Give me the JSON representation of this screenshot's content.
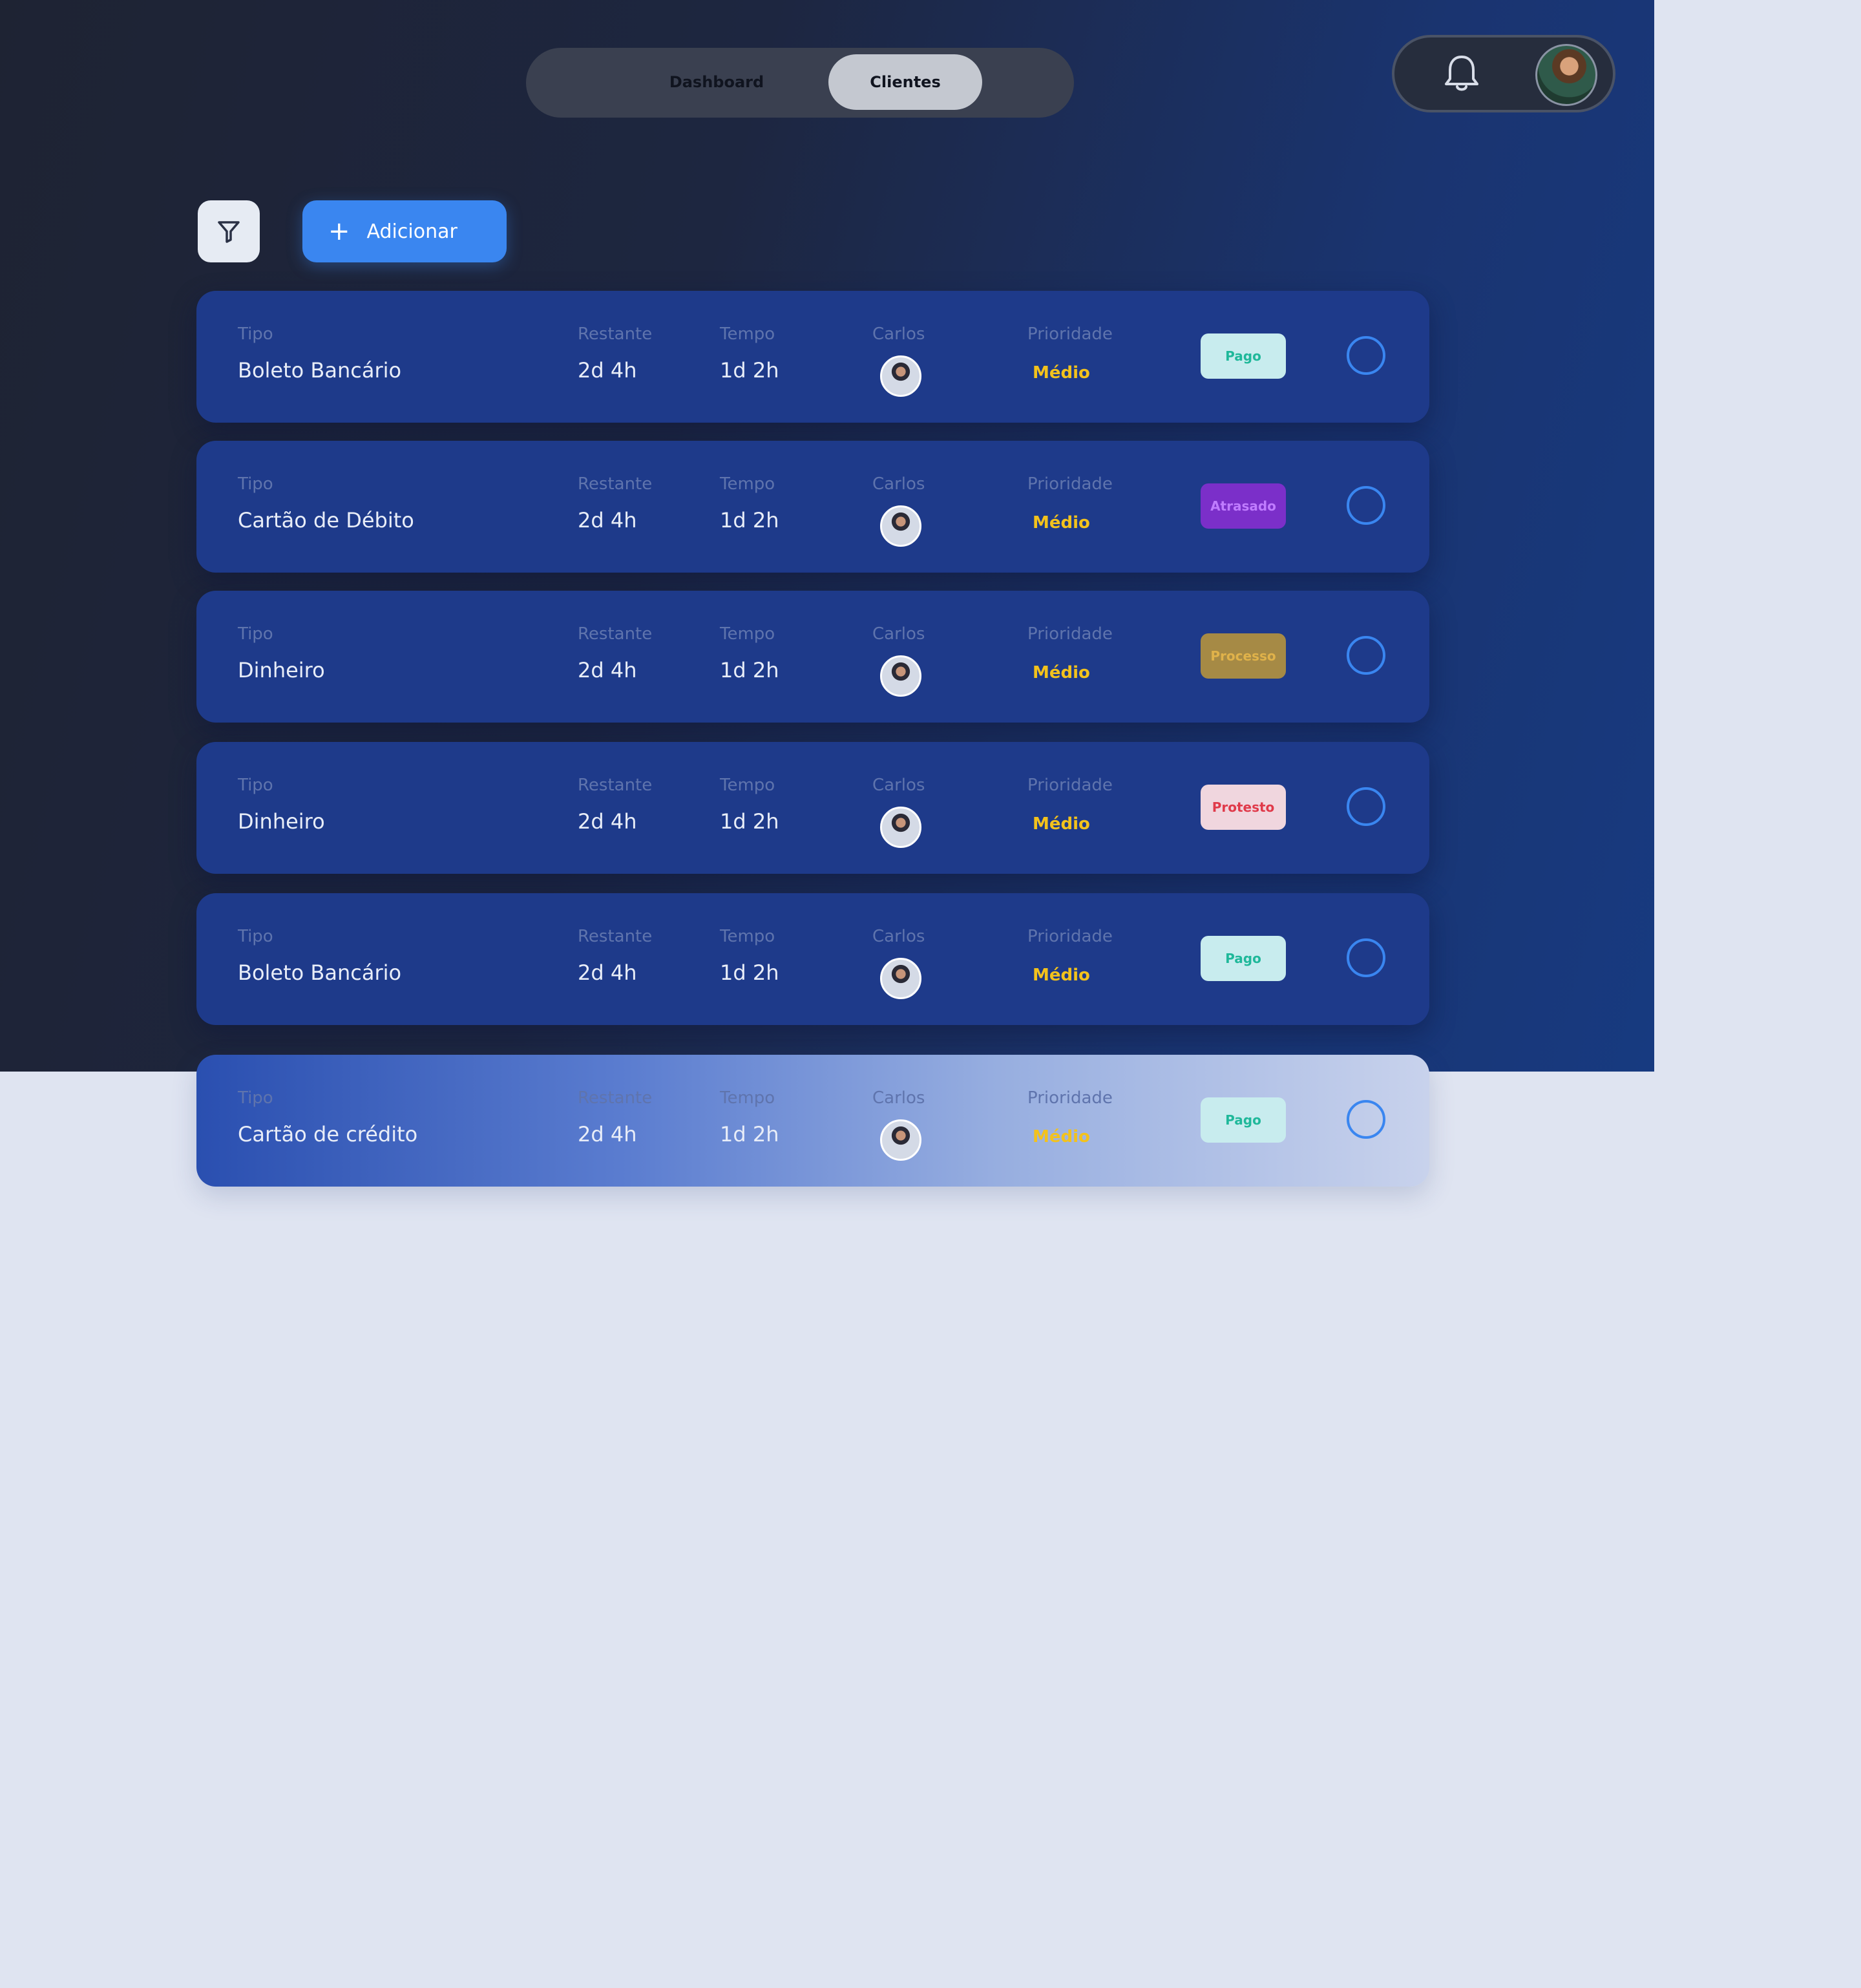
{
  "nav": {
    "tabs": [
      {
        "label": "Dashboard",
        "active": false
      },
      {
        "label": "Clientes",
        "active": true
      }
    ]
  },
  "toolbar": {
    "add_label": "Adicionar",
    "add_icon": "plus-icon",
    "filter_icon": "filter-icon"
  },
  "header_icons": {
    "notifications": "bell-icon",
    "profile": "avatar"
  },
  "colors": {
    "accent": "#3a86f0",
    "priority": "#f3c21c",
    "row_bg": "#1e3a8a"
  },
  "rows": [
    {
      "tipo_label": "Tipo",
      "tipo": "Boleto Bancário",
      "restante_label": "Restante",
      "restante": "2d 4h",
      "tempo_label": "Tempo",
      "tempo": "1d 2h",
      "responsavel": "Carlos",
      "prioridade_label": "Prioridade",
      "prioridade": "Médio",
      "status": "Pago",
      "status_bg": "#c8ecee",
      "status_color": "#1fb89a"
    },
    {
      "tipo_label": "Tipo",
      "tipo": "Cartão de Débito",
      "restante_label": "Restante",
      "restante": "2d 4h",
      "tempo_label": "Tempo",
      "tempo": "1d 2h",
      "responsavel": "Carlos",
      "prioridade_label": "Prioridade",
      "prioridade": "Médio",
      "status": "Atrasado",
      "status_bg": "#7b2fc9",
      "status_color": "#c07cff"
    },
    {
      "tipo_label": "Tipo",
      "tipo": "Dinheiro",
      "restante_label": "Restante",
      "restante": "2d 4h",
      "tempo_label": "Tempo",
      "tempo": "1d 2h",
      "responsavel": "Carlos",
      "prioridade_label": "Prioridade",
      "prioridade": "Médio",
      "status": "Processo",
      "status_bg": "#a68a45",
      "status_color": "#e0b24a"
    },
    {
      "tipo_label": "Tipo",
      "tipo": "Dinheiro",
      "restante_label": "Restante",
      "restante": "2d 4h",
      "tempo_label": "Tempo",
      "tempo": "1d 2h",
      "responsavel": "Carlos",
      "prioridade_label": "Prioridade",
      "prioridade": "Médio",
      "status": "Protesto",
      "status_bg": "#f0d6de",
      "status_color": "#e03a4a"
    },
    {
      "tipo_label": "Tipo",
      "tipo": "Boleto Bancário",
      "restante_label": "Restante",
      "restante": "2d 4h",
      "tempo_label": "Tempo",
      "tempo": "1d 2h",
      "responsavel": "Carlos",
      "prioridade_label": "Prioridade",
      "prioridade": "Médio",
      "status": "Pago",
      "status_bg": "#c8ecee",
      "status_color": "#1fb89a"
    },
    {
      "tipo_label": "Tipo",
      "tipo": "Cartão de crédito",
      "restante_label": "Restante",
      "restante": "2d 4h",
      "tempo_label": "Tempo",
      "tempo": "1d 2h",
      "responsavel": "Carlos",
      "prioridade_label": "Prioridade",
      "prioridade": "Médio",
      "status": "Pago",
      "status_bg": "#c8ecee",
      "status_color": "#1fb89a"
    }
  ]
}
